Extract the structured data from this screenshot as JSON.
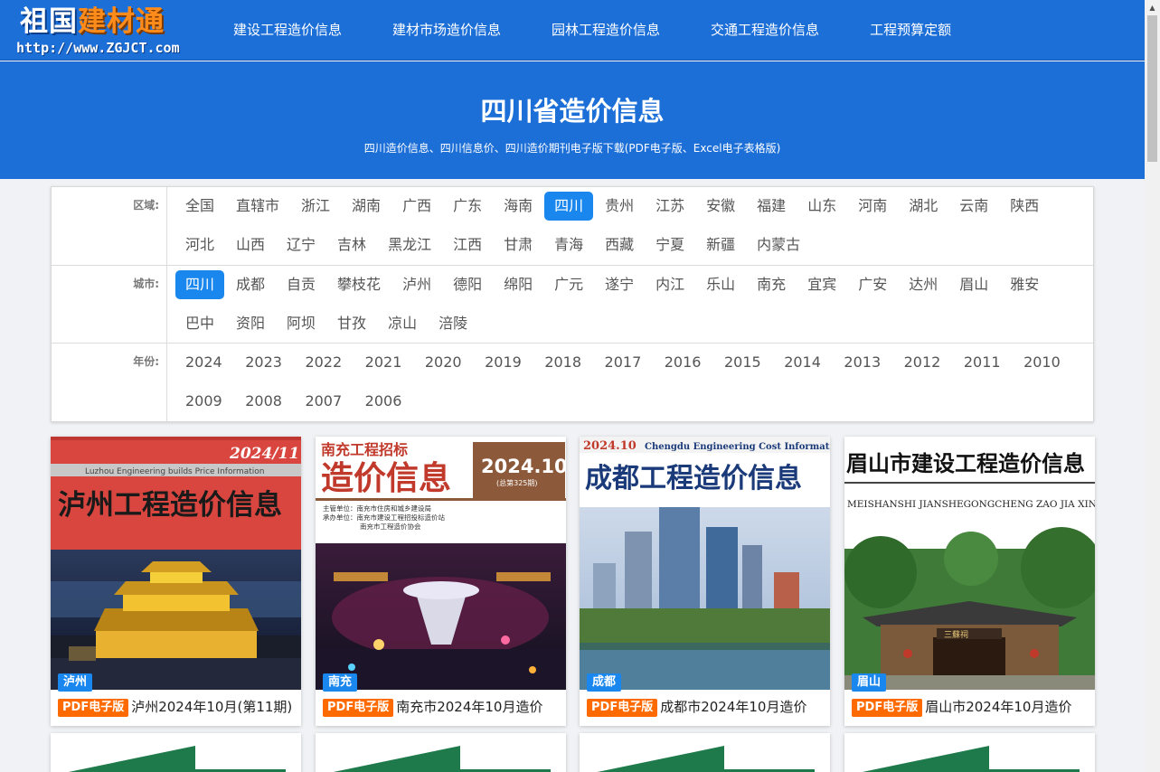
{
  "logo": {
    "part1": "祖国",
    "part2": "建材通",
    "url": "http://www.ZGJCT.com"
  },
  "nav": [
    "建设工程造价信息",
    "建材市场造价信息",
    "园林工程造价信息",
    "交通工程造价信息",
    "工程预算定额"
  ],
  "hero": {
    "title": "四川省造价信息",
    "subtitle": "四川造价信息、四川信息价、四川造价期刊电子版下载(PDF电子版、Excel电子表格版)"
  },
  "filters": {
    "region": {
      "label": "区域:",
      "options": [
        "全国",
        "直辖市",
        "浙江",
        "湖南",
        "广西",
        "广东",
        "海南",
        "四川",
        "贵州",
        "江苏",
        "安徽",
        "福建",
        "山东",
        "河南",
        "湖北",
        "云南",
        "陕西",
        "河北",
        "山西",
        "辽宁",
        "吉林",
        "黑龙江",
        "江西",
        "甘肃",
        "青海",
        "西藏",
        "宁夏",
        "新疆",
        "内蒙古"
      ],
      "selected": "四川"
    },
    "city": {
      "label": "城市:",
      "options": [
        "四川",
        "成都",
        "自贡",
        "攀枝花",
        "泸州",
        "德阳",
        "绵阳",
        "广元",
        "遂宁",
        "内江",
        "乐山",
        "南充",
        "宜宾",
        "广安",
        "达州",
        "眉山",
        "雅安",
        "巴中",
        "资阳",
        "阿坝",
        "甘孜",
        "凉山",
        "涪陵"
      ],
      "selected": "四川"
    },
    "year": {
      "label": "年份:",
      "options": [
        "2024",
        "2023",
        "2022",
        "2021",
        "2020",
        "2019",
        "2018",
        "2017",
        "2016",
        "2015",
        "2014",
        "2013",
        "2012",
        "2011",
        "2010",
        "2009",
        "2008",
        "2007",
        "2006"
      ]
    }
  },
  "cards": [
    {
      "region": "泸州",
      "badge": "PDF电子版",
      "title": "泸州2024年10月(第11期)",
      "cover_title": "泸州工程造价信息",
      "cover_issue": "2024/11",
      "cover_en": "Luzhou Engineering builds Price Information"
    },
    {
      "region": "南充",
      "badge": "PDF电子版",
      "title": "南充市2024年10月造价",
      "cover_title_top": "南充工程招标",
      "cover_title": "造价信息",
      "cover_issue": "2024.10",
      "cover_issue_no": "(总第325期)",
      "cover_org1": "主管单位：南充市住房和城乡建设局",
      "cover_org2": "承办单位：南充市建设工程招投标造价站",
      "cover_org3": "南充市工程造价协会"
    },
    {
      "region": "成都",
      "badge": "PDF电子版",
      "title": "成都市2024年10月造价",
      "cover_title": "成都工程造价信息",
      "cover_issue": "2024.10",
      "cover_en": "Chengdu Engineering Cost Information"
    },
    {
      "region": "眉山",
      "badge": "PDF电子版",
      "title": "眉山市2024年10月造价",
      "cover_title": "眉山市建设工程造价信息",
      "cover_en": "MEISHANSHI JIANSHEGONGCHENG ZAO JIA XINXI",
      "cover_sign": "三蘇祠"
    }
  ],
  "colors": {
    "primary": "#1d6fd8",
    "active": "#1a87ef",
    "badge_pdf": "#ff6a00"
  }
}
